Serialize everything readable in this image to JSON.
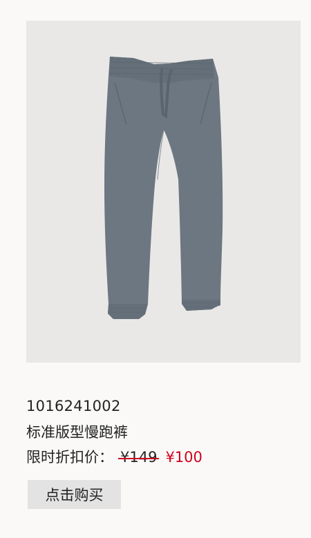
{
  "product": {
    "image_alt": "pants",
    "sku": "1016241002",
    "name": "标准版型慢跑裤",
    "price_label": "限时折扣价：",
    "original_price": "¥149",
    "sale_price": "¥100",
    "buy_label": "点击购买"
  },
  "colors": {
    "background": "#faf9f8",
    "image_background": "#e9e8e7",
    "pants": "#6c7781",
    "sale_red": "#d0021b",
    "button_bg": "#e4e3e3"
  }
}
